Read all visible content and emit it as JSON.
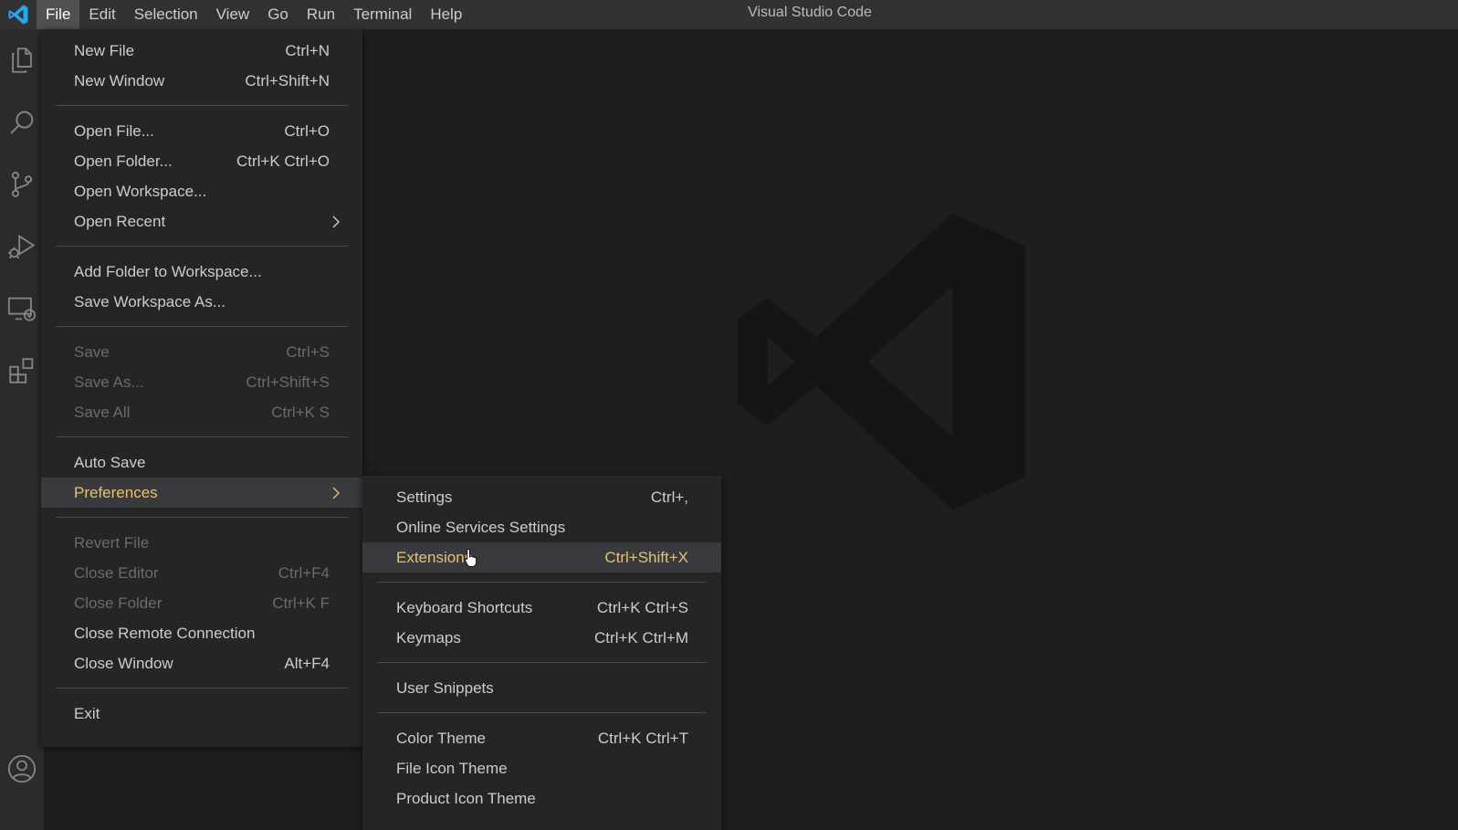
{
  "window_title": "Visual Studio Code",
  "menubar": [
    {
      "label": "File",
      "active": true
    },
    {
      "label": "Edit"
    },
    {
      "label": "Selection"
    },
    {
      "label": "View"
    },
    {
      "label": "Go"
    },
    {
      "label": "Run"
    },
    {
      "label": "Terminal"
    },
    {
      "label": "Help"
    }
  ],
  "activity_bar": {
    "icons": [
      "explorer-icon",
      "search-icon",
      "source-control-icon",
      "run-debug-icon",
      "remote-explorer-icon",
      "extensions-icon",
      "account-icon"
    ]
  },
  "file_menu": {
    "new_file": {
      "label": "New File",
      "shortcut": "Ctrl+N"
    },
    "new_window": {
      "label": "New Window",
      "shortcut": "Ctrl+Shift+N"
    },
    "open_file": {
      "label": "Open File...",
      "shortcut": "Ctrl+O"
    },
    "open_folder": {
      "label": "Open Folder...",
      "shortcut": "Ctrl+K Ctrl+O"
    },
    "open_workspace": {
      "label": "Open Workspace..."
    },
    "open_recent": {
      "label": "Open Recent"
    },
    "add_folder": {
      "label": "Add Folder to Workspace..."
    },
    "save_workspace_as": {
      "label": "Save Workspace As..."
    },
    "save": {
      "label": "Save",
      "shortcut": "Ctrl+S"
    },
    "save_as": {
      "label": "Save As...",
      "shortcut": "Ctrl+Shift+S"
    },
    "save_all": {
      "label": "Save All",
      "shortcut": "Ctrl+K S"
    },
    "auto_save": {
      "label": "Auto Save"
    },
    "preferences": {
      "label": "Preferences"
    },
    "revert_file": {
      "label": "Revert File"
    },
    "close_editor": {
      "label": "Close Editor",
      "shortcut": "Ctrl+F4"
    },
    "close_folder": {
      "label": "Close Folder",
      "shortcut": "Ctrl+K F"
    },
    "close_remote": {
      "label": "Close Remote Connection"
    },
    "close_window": {
      "label": "Close Window",
      "shortcut": "Alt+F4"
    },
    "exit": {
      "label": "Exit"
    }
  },
  "preferences_menu": {
    "settings": {
      "label": "Settings",
      "shortcut": "Ctrl+,"
    },
    "online_services": {
      "label": "Online Services Settings"
    },
    "extensions": {
      "label": "Extensions",
      "shortcut": "Ctrl+Shift+X"
    },
    "keyboard_shortcuts": {
      "label": "Keyboard Shortcuts",
      "shortcut": "Ctrl+K Ctrl+S"
    },
    "keymaps": {
      "label": "Keymaps",
      "shortcut": "Ctrl+K Ctrl+M"
    },
    "user_snippets": {
      "label": "User Snippets"
    },
    "color_theme": {
      "label": "Color Theme",
      "shortcut": "Ctrl+K Ctrl+T"
    },
    "file_icon_theme": {
      "label": "File Icon Theme"
    },
    "product_icon_theme": {
      "label": "Product Icon Theme"
    }
  },
  "colors": {
    "accent_highlight": "#e8c26a",
    "logo_blue": "#23a9f2",
    "menu_bg": "#252526",
    "titlebar_bg": "#323233"
  }
}
